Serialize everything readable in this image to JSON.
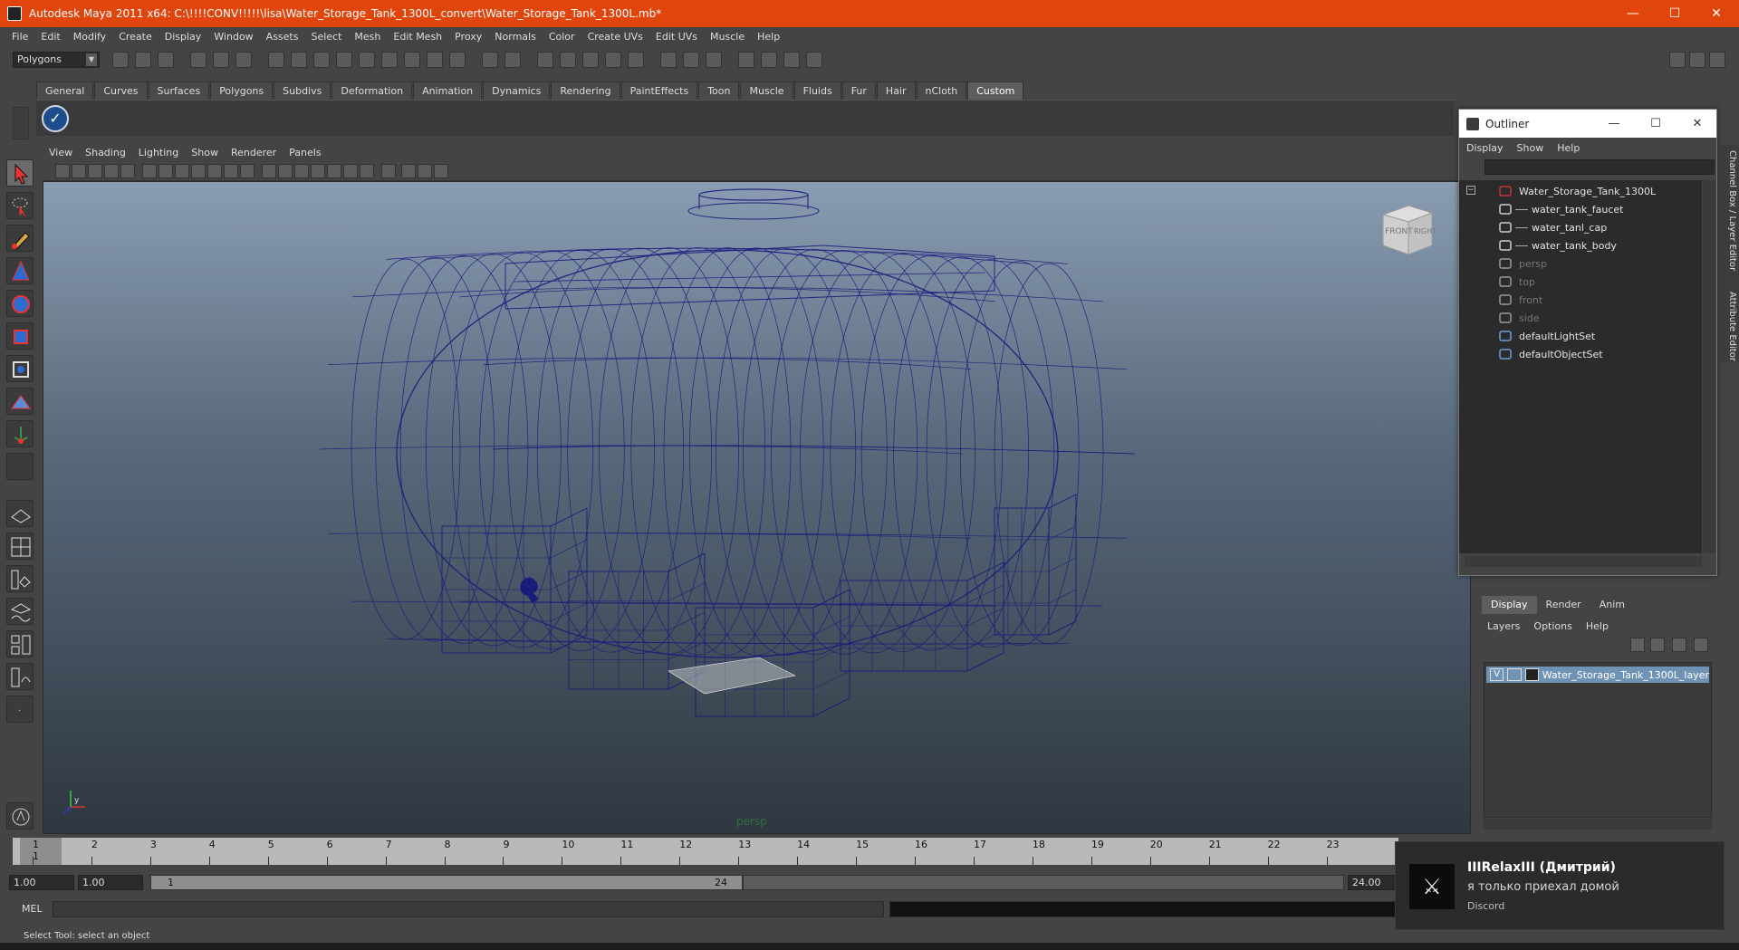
{
  "window": {
    "title": "Autodesk Maya 2011 x64: C:\\!!!!CONV!!!!!\\lisa\\Water_Storage_Tank_1300L_convert\\Water_Storage_Tank_1300L.mb*",
    "minimize": "—",
    "maximize": "☐",
    "close": "✕"
  },
  "menubar": [
    "File",
    "Edit",
    "Modify",
    "Create",
    "Display",
    "Window",
    "Assets",
    "Select",
    "Mesh",
    "Edit Mesh",
    "Proxy",
    "Normals",
    "Color",
    "Create UVs",
    "Edit UVs",
    "Muscle",
    "Help"
  ],
  "statusline": {
    "mode": "Polygons"
  },
  "shelf": {
    "tabs": [
      "General",
      "Curves",
      "Surfaces",
      "Polygons",
      "Subdivs",
      "Deformation",
      "Animation",
      "Dynamics",
      "Rendering",
      "PaintEffects",
      "Toon",
      "Muscle",
      "Fluids",
      "Fur",
      "Hair",
      "nCloth",
      "Custom"
    ],
    "active_tab": "Custom",
    "custom_icon": "checkmark-icon"
  },
  "panel": {
    "menu": [
      "View",
      "Shading",
      "Lighting",
      "Show",
      "Renderer",
      "Panels"
    ],
    "camera": "persp",
    "viewcube": {
      "front": "FRONT",
      "right": "RIGHT"
    },
    "wire_color": "#1a1c7a"
  },
  "outliner": {
    "title": "Outliner",
    "menu": [
      "Display",
      "Show",
      "Help"
    ],
    "items": [
      {
        "label": "Water_Storage_Tank_1300L",
        "dim": false,
        "icon": "transform-icon"
      },
      {
        "label": "water_tank_faucet",
        "dim": false,
        "icon": "mesh-icon"
      },
      {
        "label": "water_tanl_cap",
        "dim": false,
        "icon": "mesh-icon"
      },
      {
        "label": "water_tank_body",
        "dim": false,
        "icon": "mesh-icon"
      },
      {
        "label": "persp",
        "dim": true,
        "icon": "camera-icon"
      },
      {
        "label": "top",
        "dim": true,
        "icon": "camera-icon"
      },
      {
        "label": "front",
        "dim": true,
        "icon": "camera-icon"
      },
      {
        "label": "side",
        "dim": true,
        "icon": "camera-icon"
      },
      {
        "label": "defaultLightSet",
        "dim": false,
        "icon": "set-icon"
      },
      {
        "label": "defaultObjectSet",
        "dim": false,
        "icon": "set-icon"
      }
    ]
  },
  "layer_editor": {
    "tabs": [
      "Display",
      "Render",
      "Anim"
    ],
    "active_tab": "Display",
    "menu": [
      "Layers",
      "Options",
      "Help"
    ],
    "layer": {
      "visible": "V",
      "name": "Water_Storage_Tank_1300L_layer"
    }
  },
  "sidetabs": [
    "Channel Box / Layer Editor",
    "Attribute Editor"
  ],
  "timeslider": {
    "ticks": [
      "1",
      "2",
      "3",
      "4",
      "5",
      "6",
      "7",
      "8",
      "9",
      "10",
      "11",
      "12",
      "13",
      "14",
      "15",
      "16",
      "17",
      "18",
      "19",
      "20",
      "21",
      "22",
      "23"
    ],
    "current": "1"
  },
  "rangeslider": {
    "start": "1.00",
    "anim_start": "1.00",
    "range_start": "1",
    "range_end": "24",
    "anim_end": "24.00"
  },
  "cmdline": {
    "label": "MEL"
  },
  "helpline": {
    "text": "Select Tool: select an object"
  },
  "notification": {
    "name": "IIIRelaxIII (Дмитрий)",
    "message": "я только приехал домой",
    "app": "Discord"
  }
}
